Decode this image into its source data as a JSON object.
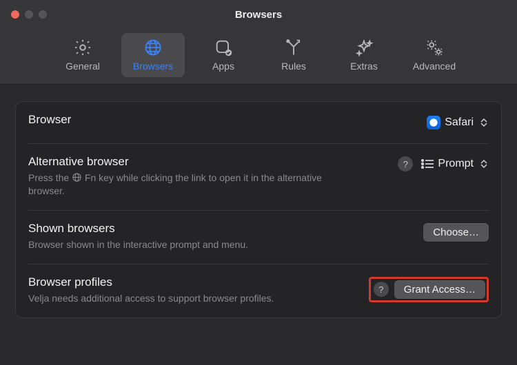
{
  "window": {
    "title": "Browsers"
  },
  "toolbar": {
    "items": [
      {
        "label": "General"
      },
      {
        "label": "Browsers"
      },
      {
        "label": "Apps"
      },
      {
        "label": "Rules"
      },
      {
        "label": "Extras"
      },
      {
        "label": "Advanced"
      }
    ],
    "active_index": 1
  },
  "sections": {
    "browser": {
      "title": "Browser",
      "selected": "Safari"
    },
    "alt_browser": {
      "title": "Alternative browser",
      "desc_prefix": "Press the ",
      "desc_suffix": " Fn key while clicking the link to open it in the alternative browser.",
      "selected": "Prompt",
      "help": "?"
    },
    "shown": {
      "title": "Shown browsers",
      "desc": "Browser shown in the interactive prompt and menu.",
      "button": "Choose…"
    },
    "profiles": {
      "title": "Browser profiles",
      "desc": "Velja needs additional access to support browser profiles.",
      "button": "Grant Access…",
      "help": "?"
    }
  }
}
